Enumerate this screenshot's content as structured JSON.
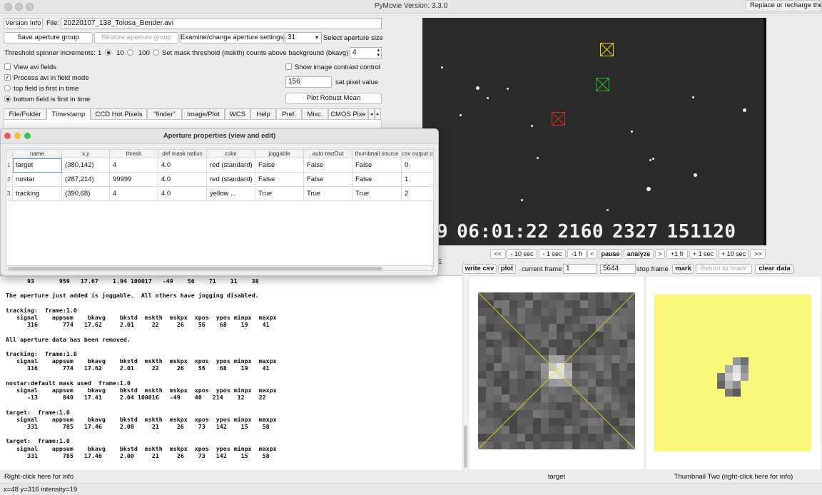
{
  "window": {
    "title": "PyMovie  Version: 3.3.0",
    "tooltip": "Replace or recharge the"
  },
  "top": {
    "version_button": "Version Info",
    "file_label": "File:",
    "file_value": "20220107_138_Tolosa_Bender.avi",
    "save_aperture_group": "Save aperture group",
    "restore_aperture_group": "Restore aperture group",
    "examine_aperture_settings": "Examine/change aperture settings",
    "aperture_size_value": "31",
    "select_aperture_size": "Select aperture size",
    "threshold_label": "Threshold spinner increments:",
    "threshold_options": [
      "1",
      "10",
      "100"
    ],
    "mask_threshold_label": "Set mask threshold (mskth) counts above background (bkavg)",
    "mask_threshold_value": "4",
    "view_avi_fields": "View avi fields",
    "process_avi_field_mode": "Process avi in field mode",
    "top_field_first": "top field is first in time",
    "bottom_field_first": "bottom field is first in time",
    "show_contrast": "Show image contrast control",
    "sat_pixel_value": "156",
    "sat_pixel_label": "sat.pixel value",
    "plot_robust_mean": "Plot Robust Mean",
    "tabs": [
      "File/Folder",
      "Timestamp",
      "CCD Hot Pixels",
      "\"finder\"",
      "Image/Plot",
      "WCS",
      "Help",
      "Pref.",
      "Misc.",
      "CMOS Pixe"
    ]
  },
  "dialog": {
    "title": "Aperture properties (view and edit)",
    "columns": [
      "name",
      "x,y",
      "thresh",
      "def mask radius",
      "color",
      "joggable",
      "auto textOut",
      "thumbnail source",
      "csv output o"
    ],
    "rows": [
      [
        "target",
        "(380,142)",
        "4",
        "4.0",
        "red (standard)",
        "False",
        "False",
        "False",
        "0"
      ],
      [
        "nostar",
        "(287,214)",
        "99999",
        "4.0",
        "red (standard)",
        "False",
        "False",
        "False",
        "1"
      ],
      [
        "tracking",
        "(390,68)",
        "4",
        "4.0",
        "yellow ...",
        "True",
        "True",
        "True",
        "2"
      ]
    ]
  },
  "video": {
    "timestamp": [
      "9",
      "06:01:22",
      "2160",
      "2327",
      "151120"
    ],
    "colors": {
      "target": "#e0271f",
      "nostar": "#2fb52f",
      "tracking": "#e8dc1a"
    }
  },
  "playback": {
    "buttons": [
      "<<",
      "- 10 sec",
      "- 1 sec",
      "-1 fr",
      "<",
      "pause",
      "analyze",
      ">",
      "+1 fr",
      "+ 1 sec",
      "+ 10 sec",
      ">>"
    ],
    "write_csv": "write csv",
    "plot": "plot",
    "current_frame_label": "current frame",
    "current_frame_value": "1",
    "stop_frame_value": "5644",
    "stop_frame_label": "stop frame",
    "mark": "mark",
    "return_to_mark": "Return to 'mark'",
    "clear_data": "clear data",
    "stray_e": "E"
  },
  "log": {
    "lines": [
      "      93       959   17.67    1.94 100017   -49    56    71    11    38",
      "",
      "The aperture just added is joggable.  All others have jogging disabled.",
      "",
      "tracking:  frame:1.0",
      "   signal    appsum    bkavg    bkstd  mskth  mskpx  xpos  ypos minpx  maxpx",
      "      316       774   17.62     2.01     22     26    56    68    19    41",
      "",
      "All aperture data has been removed.",
      "",
      "tracking:  frame:1.0",
      "   signal    appsum    bkavg    bkstd  mskth  mskpx  xpos  ypos minpx  maxpx",
      "      316       774   17.62     2.01     22     26    56    68    19    41",
      "",
      "nostar:default mask used  frame:1.0",
      "   signal    appsum    bkavg    bkstd  mskth  mskpx  xpos  ypos minpx  maxpx",
      "      -13       840   17.41     2.04 100016   -49    40   214    12    22",
      "",
      "target:  frame:1.0",
      "   signal    appsum    bkavg    bkstd  mskth  mskpx  xpos  ypos minpx  maxpx",
      "      331       785   17.46     2.00     21     26    73   142    15    58",
      "",
      "target:  frame:1.0",
      "   signal    appsum    bkavg    bkstd  mskth  mskpx  xpos  ypos minpx  maxpx",
      "      331       785   17.46     2.00     21     26    73   142    15    58"
    ]
  },
  "thumbs": {
    "one_label": "target",
    "two_label": "Thumbnail Two (right-click here for info)"
  },
  "status": {
    "left_info": "Right-click here for info",
    "pixel_readout": "x=48 y=316 intensity=19"
  }
}
